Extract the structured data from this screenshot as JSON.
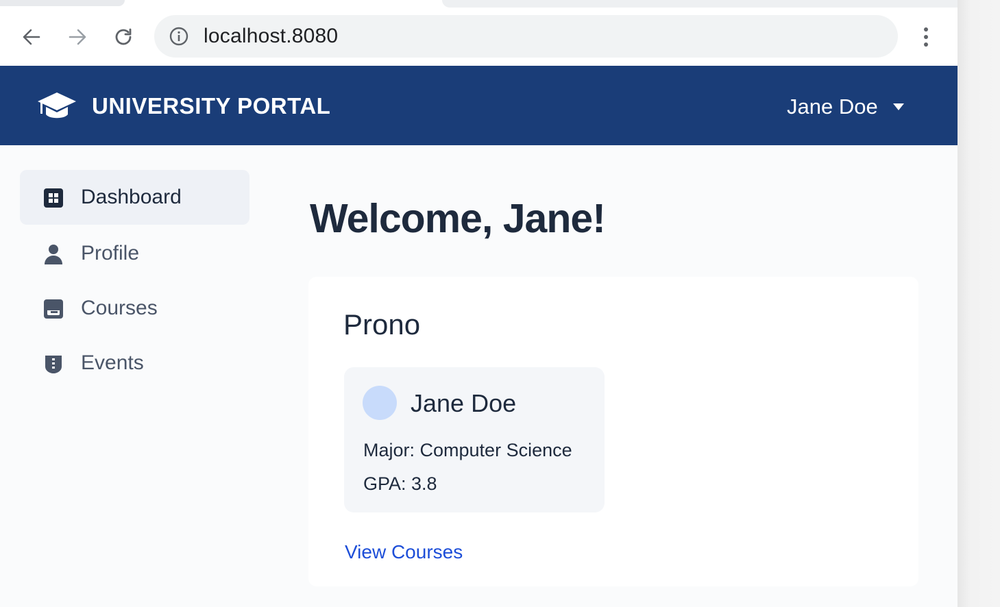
{
  "browser": {
    "url": "localhost.8080"
  },
  "header": {
    "title": "UNIVERSITY PORTAL",
    "user_name": "Jane Doe",
    "logo_icon": "graduation-cap-icon"
  },
  "sidebar": {
    "items": [
      {
        "label": "Dashboard",
        "icon": "dashboard-grid-icon",
        "active": true
      },
      {
        "label": "Profile",
        "icon": "person-icon",
        "active": false
      },
      {
        "label": "Courses",
        "icon": "courses-icon",
        "active": false
      },
      {
        "label": "Events",
        "icon": "events-icon",
        "active": false
      }
    ]
  },
  "main": {
    "heading": "Welcome, Jane!",
    "panel_title": "Prono",
    "profile": {
      "name": "Jane Doe",
      "major": "Major: Computer Science",
      "gpa": "GPA: 3.8"
    },
    "view_courses_link": "View Courses"
  },
  "colors": {
    "header_bg": "#1a3d78",
    "link": "#1d4ed8",
    "avatar": "#c8dbfb"
  }
}
